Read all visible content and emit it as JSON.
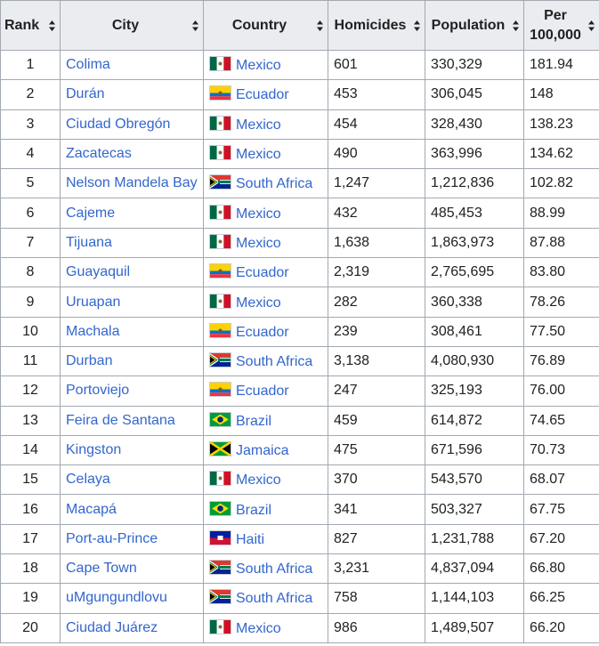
{
  "columns": [
    "Rank",
    "City",
    "Country",
    "Homicides",
    "Population",
    "Per 100,000"
  ],
  "rows": [
    {
      "rank": "1",
      "city": "Colima",
      "country": "Mexico",
      "flag": "mexico-flag-icon",
      "homicides": "601",
      "population": "330,329",
      "per": "181.94"
    },
    {
      "rank": "2",
      "city": "Durán",
      "country": "Ecuador",
      "flag": "ecuador-flag-icon",
      "homicides": "453",
      "population": "306,045",
      "per": "148"
    },
    {
      "rank": "3",
      "city": "Ciudad Obregón",
      "country": "Mexico",
      "flag": "mexico-flag-icon",
      "homicides": "454",
      "population": "328,430",
      "per": "138.23"
    },
    {
      "rank": "4",
      "city": "Zacatecas",
      "country": "Mexico",
      "flag": "mexico-flag-icon",
      "homicides": "490",
      "population": "363,996",
      "per": "134.62"
    },
    {
      "rank": "5",
      "city": "Nelson Mandela Bay",
      "country": "South Africa",
      "flag": "south-africa-flag-icon",
      "homicides": "1,247",
      "population": "1,212,836",
      "per": "102.82"
    },
    {
      "rank": "6",
      "city": "Cajeme",
      "country": "Mexico",
      "flag": "mexico-flag-icon",
      "homicides": "432",
      "population": "485,453",
      "per": "88.99"
    },
    {
      "rank": "7",
      "city": "Tijuana",
      "country": "Mexico",
      "flag": "mexico-flag-icon",
      "homicides": "1,638",
      "population": "1,863,973",
      "per": "87.88"
    },
    {
      "rank": "8",
      "city": "Guayaquil",
      "country": "Ecuador",
      "flag": "ecuador-flag-icon",
      "homicides": "2,319",
      "population": "2,765,695",
      "per": "83.80"
    },
    {
      "rank": "9",
      "city": "Uruapan",
      "country": "Mexico",
      "flag": "mexico-flag-icon",
      "homicides": "282",
      "population": "360,338",
      "per": "78.26"
    },
    {
      "rank": "10",
      "city": "Machala",
      "country": "Ecuador",
      "flag": "ecuador-flag-icon",
      "homicides": "239",
      "population": "308,461",
      "per": "77.50"
    },
    {
      "rank": "11",
      "city": "Durban",
      "country": "South Africa",
      "flag": "south-africa-flag-icon",
      "homicides": "3,138",
      "population": "4,080,930",
      "per": "76.89"
    },
    {
      "rank": "12",
      "city": "Portoviejo",
      "country": "Ecuador",
      "flag": "ecuador-flag-icon",
      "homicides": "247",
      "population": "325,193",
      "per": "76.00"
    },
    {
      "rank": "13",
      "city": "Feira de Santana",
      "country": "Brazil",
      "flag": "brazil-flag-icon",
      "homicides": "459",
      "population": "614,872",
      "per": "74.65"
    },
    {
      "rank": "14",
      "city": "Kingston",
      "country": "Jamaica",
      "flag": "jamaica-flag-icon",
      "homicides": "475",
      "population": "671,596",
      "per": "70.73"
    },
    {
      "rank": "15",
      "city": "Celaya",
      "country": "Mexico",
      "flag": "mexico-flag-icon",
      "homicides": "370",
      "population": "543,570",
      "per": "68.07"
    },
    {
      "rank": "16",
      "city": "Macapá",
      "country": "Brazil",
      "flag": "brazil-flag-icon",
      "homicides": "341",
      "population": "503,327",
      "per": "67.75"
    },
    {
      "rank": "17",
      "city": "Port-au-Prince",
      "country": "Haiti",
      "flag": "haiti-flag-icon",
      "homicides": "827",
      "population": "1,231,788",
      "per": "67.20"
    },
    {
      "rank": "18",
      "city": "Cape Town",
      "country": "South Africa",
      "flag": "south-africa-flag-icon",
      "homicides": "3,231",
      "population": "4,837,094",
      "per": "66.80"
    },
    {
      "rank": "19",
      "city": "uMgungundlovu",
      "country": "South Africa",
      "flag": "south-africa-flag-icon",
      "homicides": "758",
      "population": "1,144,103",
      "per": "66.25"
    },
    {
      "rank": "20",
      "city": "Ciudad Juárez",
      "country": "Mexico",
      "flag": "mexico-flag-icon",
      "homicides": "986",
      "population": "1,489,507",
      "per": "66.20"
    }
  ]
}
